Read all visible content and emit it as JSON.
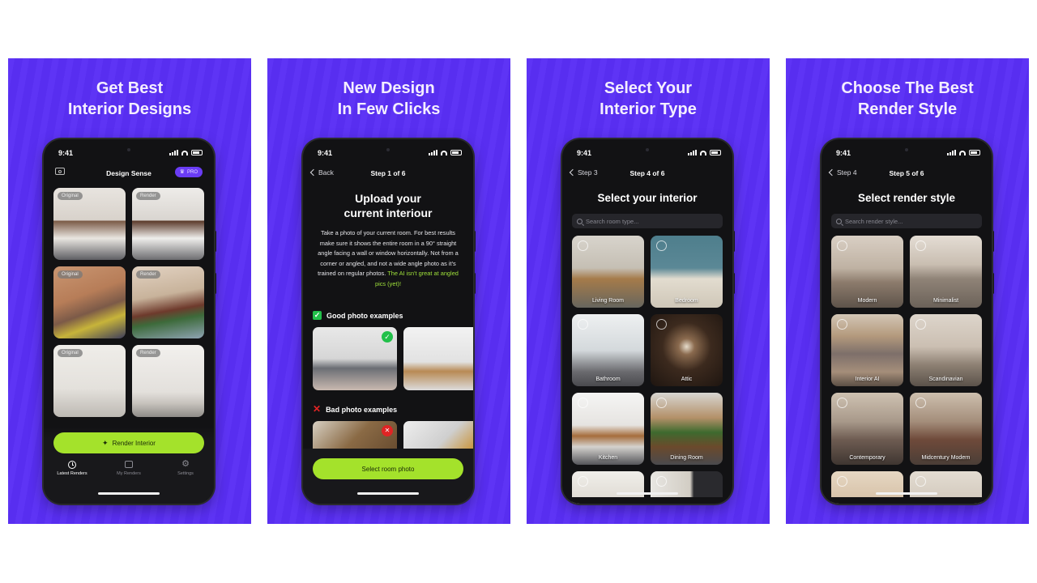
{
  "colors": {
    "panel_bg": "#5a2ff5",
    "accent_green": "#a4e22b",
    "pro_badge": "#6a3cf5",
    "good_green": "#22c04a",
    "bad_red": "#e02424"
  },
  "panels": [
    {
      "headline_line1": "Get Best",
      "headline_line2": "Interior Designs",
      "screen": {
        "time": "9:41",
        "title": "Design Sense",
        "pro_badge": "PRO",
        "tiles": [
          {
            "badge": "Original"
          },
          {
            "badge": "Render"
          },
          {
            "badge": "Original"
          },
          {
            "badge": "Render"
          },
          {
            "badge": "Original"
          },
          {
            "badge": "Render"
          }
        ],
        "cta_label": "Render Interior",
        "tabs": [
          {
            "label": "Latest Renders",
            "icon": "clock-icon",
            "active": true
          },
          {
            "label": "My Renders",
            "icon": "gallery-icon",
            "active": false
          },
          {
            "label": "Settings",
            "icon": "gear-icon",
            "active": false
          }
        ]
      }
    },
    {
      "headline_line1": "New Design",
      "headline_line2": "In Few Clicks",
      "screen": {
        "time": "9:41",
        "back_label": "Back",
        "step_label": "Step 1 of 6",
        "heading_line1": "Upload your",
        "heading_line2": "current interiour",
        "body_text": "Take a photo of your current room. For best results make sure it shows the entire room in a 90° straight angle facing a wall or window horizontally. Not from a corner or angled, and not a wide angle photo as it's trained on regular photos.",
        "body_highlight": "The AI isn't great at angled pics (yet)!",
        "good_label": "Good photo examples",
        "bad_label": "Bad photo examples",
        "cta_label": "Select room photo"
      }
    },
    {
      "headline_line1": "Select Your",
      "headline_line2": "Interior Type",
      "screen": {
        "time": "9:41",
        "back_label": "Step 3",
        "step_label": "Step 4 of 6",
        "heading": "Select your interior",
        "search_placeholder": "Search room type...",
        "tiles": [
          {
            "label": "Living Room"
          },
          {
            "label": "Bedroom"
          },
          {
            "label": "Bathroom"
          },
          {
            "label": "Attic"
          },
          {
            "label": "Kitchen"
          },
          {
            "label": "Dining Room"
          },
          {
            "label": ""
          },
          {
            "label": ""
          }
        ]
      }
    },
    {
      "headline_line1": "Choose The Best",
      "headline_line2": "Render Style",
      "screen": {
        "time": "9:41",
        "back_label": "Step 4",
        "step_label": "Step 5 of 6",
        "heading": "Select render style",
        "search_placeholder": "Search render style...",
        "tiles": [
          {
            "label": "Modern"
          },
          {
            "label": "Minimalist"
          },
          {
            "label": "Interior AI"
          },
          {
            "label": "Scandinavian"
          },
          {
            "label": "Contemporary"
          },
          {
            "label": "Midcentury Modern"
          },
          {
            "label": ""
          },
          {
            "label": ""
          }
        ]
      }
    }
  ]
}
